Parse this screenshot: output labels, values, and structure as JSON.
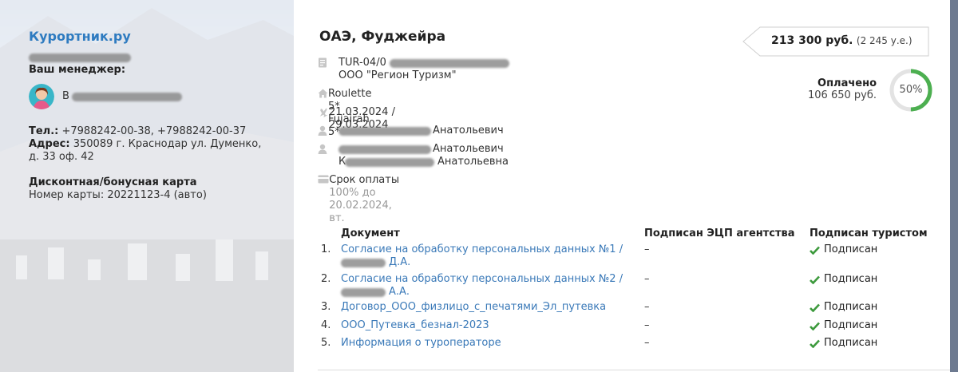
{
  "agency": {
    "brand": "Курортник.ру",
    "manager_label": "Ваш менеджер:",
    "manager_name": "В",
    "phone_label": "Тел.:",
    "phone_value": "+7988242-00-38, +7988242-00-37",
    "address_label": "Адрес:",
    "address_value": "350089 г. Краснодар ул. Думенко, д. 33 оф. 42",
    "card_title": "Дисконтная/бонусная карта",
    "card_number": "Номер карты: 20221123-4 (авто)"
  },
  "tour": {
    "title": "ОАЭ, Фуджейра",
    "price_amount": "213 300 руб.",
    "price_ue": "(2 245 у.е.)",
    "paid_label": "Оплачено",
    "paid_amount": "106 650 руб.",
    "paid_percent_text": "50%",
    "paid_fraction": 0.5,
    "order_number": "TUR-04/0",
    "operator": "ООО \"Регион Туризм\"",
    "hotel": "Roulette 5* Fujairah 5*",
    "dates": "21.03.2024 / 29.03.2024",
    "flight_tourist_suffix": "Анатольевич",
    "tourists_line1_suffix": "Анатольевич",
    "tourists_line2_prefix": "К",
    "tourists_line2_suffix": "Анатольевна",
    "payment_label": "Срок оплаты",
    "payment_value": "100% до 20.02.2024, вт."
  },
  "documents": {
    "headers": {
      "document": "Документ",
      "agency_signed": "Подписан ЭЦП агентства",
      "tourist_signed": "Подписан туристом"
    },
    "rows": [
      {
        "num": "1.",
        "name_line1": "Согласие на обработку персональных данных №1 /",
        "name_line2": "Д.А.",
        "agency": "–",
        "tourist": "Подписан"
      },
      {
        "num": "2.",
        "name_line1": "Согласие на обработку персональных данных №2 /",
        "name_line2": "А.А.",
        "agency": "–",
        "tourist": "Подписан"
      },
      {
        "num": "3.",
        "name_line1": "Договор_ООО_физлицо_с_печатями_Эл_путевка",
        "agency": "–",
        "tourist": "Подписан"
      },
      {
        "num": "4.",
        "name_line1": "ООО_Путевка_безнал-2023",
        "agency": "–",
        "tourist": "Подписан"
      },
      {
        "num": "5.",
        "name_line1": "Информация о туроператоре",
        "agency": "–",
        "tourist": "Подписан"
      }
    ]
  },
  "colors": {
    "brand_blue": "#2e7bc0",
    "link_blue": "#3a79b8",
    "check_green": "#3d9a3d",
    "ring_green": "#4caf50",
    "ring_track": "#e3e3e3"
  },
  "icons": [
    "document-icon",
    "home-icon",
    "plane-icon",
    "person-icon",
    "card-icon",
    "check-icon"
  ]
}
